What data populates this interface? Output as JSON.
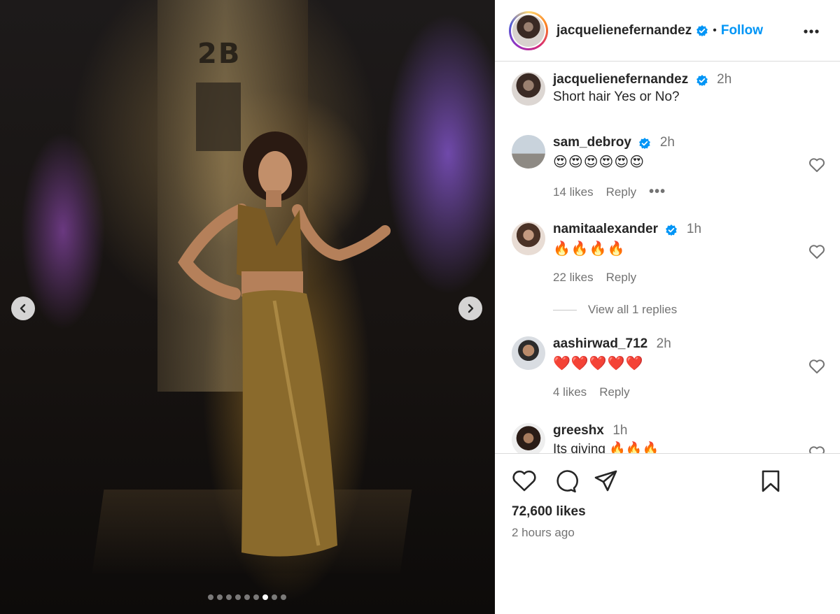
{
  "post": {
    "author": "jacquelienefernandez",
    "follow_label": "Follow",
    "caption": "Short hair Yes or No?",
    "caption_time": "2h",
    "likes": "72,600 likes",
    "posted": "2 hours ago",
    "carousel": {
      "slide_count": 9,
      "active_slide": 7
    },
    "photo_sign_text": "2B"
  },
  "comments": [
    {
      "user": "sam_debroy",
      "verified": true,
      "time": "2h",
      "text": "😍😍😍😍😍😍",
      "likes": "14 likes",
      "reply": "Reply",
      "has_more": true
    },
    {
      "user": "namitaalexander",
      "verified": true,
      "time": "1h",
      "text": "🔥🔥🔥🔥",
      "likes": "22 likes",
      "reply": "Reply",
      "view_replies": "View all 1 replies"
    },
    {
      "user": "aashirwad_712",
      "verified": false,
      "time": "2h",
      "text": "❤️❤️❤️❤️❤️",
      "likes": "4 likes",
      "reply": "Reply"
    },
    {
      "user": "greeshx",
      "verified": false,
      "time": "1h",
      "text": "Its giving 🔥🔥🔥"
    }
  ],
  "icons": {
    "like": "heart-icon",
    "comment": "comment-icon",
    "share": "share-icon",
    "save": "bookmark-icon",
    "more": "more-options-icon",
    "verified": "verified-badge-icon",
    "prev": "chevron-left-icon",
    "next": "chevron-right-icon"
  },
  "colors": {
    "link": "#0095f6",
    "verified": "#0095f6",
    "muted": "#737373",
    "text": "#262626"
  }
}
